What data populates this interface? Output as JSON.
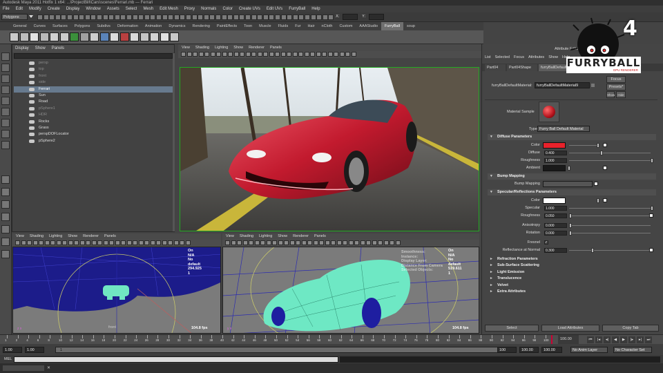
{
  "window": {
    "title": "Autodesk Maya 2011 Hotfix 1 x64: ...\\ProjectBill\\Cars\\scenes\\Ferrari.mb --- Ferrari"
  },
  "menu": [
    "File",
    "Edit",
    "Modify",
    "Create",
    "Display",
    "Window",
    "Assets",
    "Select",
    "Mesh",
    "Edit Mesh",
    "Proxy",
    "Normals",
    "Color",
    "Create UVs",
    "Edit UVs",
    "FurryBall",
    "Help"
  ],
  "status": {
    "mode": "Polygons",
    "x_label": "X:",
    "y_label": "Y:"
  },
  "shelf": {
    "tabs": [
      "General",
      "Curves",
      "Surfaces",
      "Polygons",
      "Subdivs",
      "Deformation",
      "Animation",
      "Dynamics",
      "Rendering",
      "PaintEffects",
      "Toon",
      "Muscle",
      "Fluids",
      "Fur",
      "Hair",
      "nCloth",
      "Custom",
      "AAAStudio",
      "FurryBall",
      "soup"
    ],
    "active_tab": "FurryBall",
    "icons": [
      "#c9c9c9",
      "#bdbdbd",
      "#e3e3e3",
      "#b8b8b8",
      "#d0d0d0",
      "#ccc",
      "#3b8f3b",
      "#a0a0a0",
      "#ccc",
      "#5a83b8",
      "#dcdcdc",
      "#b84040",
      "#dadada",
      "#c4c4c4",
      "#d3d3d3",
      "#e0e0e0",
      "#c7c7c7"
    ]
  },
  "outliner": {
    "menu": [
      "Display",
      "Show",
      "Panels"
    ],
    "items": [
      {
        "label": "persp",
        "state": "dim"
      },
      {
        "label": "top",
        "state": "dim"
      },
      {
        "label": "front",
        "state": "dim"
      },
      {
        "label": "side",
        "state": "dim"
      },
      {
        "label": "Ferrari",
        "state": "sel"
      },
      {
        "label": "Sun",
        "state": "normal"
      },
      {
        "label": "Road",
        "state": "normal"
      },
      {
        "label": "pSphere1",
        "state": "dim"
      },
      {
        "label": "HDR",
        "state": "dim"
      },
      {
        "label": "Rocks",
        "state": "normal"
      },
      {
        "label": "Grass",
        "state": "normal"
      },
      {
        "label": "perspDOFLocator",
        "state": "normal"
      },
      {
        "label": "pSphere2",
        "state": "normal"
      }
    ]
  },
  "render_view": {
    "menu": [
      "View",
      "Shading",
      "Lighting",
      "Show",
      "Renderer",
      "Panels"
    ]
  },
  "viewport_left": {
    "menu": [
      "View",
      "Shading",
      "Lighting",
      "Show",
      "Renderer",
      "Panels"
    ],
    "hud": [
      "On",
      "N/A",
      "No",
      "default",
      "294.925",
      "1"
    ],
    "fps": "104.8 fps",
    "label": "front"
  },
  "viewport_right": {
    "menu": [
      "View",
      "Shading",
      "Lighting",
      "Show",
      "Renderer",
      "Panels"
    ],
    "hud_labels": [
      "Smoothness:",
      "Instance:",
      "Display Layer:",
      "Distance From Camera:",
      "Selected Objects:"
    ],
    "hud": [
      "On",
      "N/A",
      "No",
      "default",
      "519.611",
      "1"
    ],
    "fps": "104.8 fps"
  },
  "attribute_editor": {
    "title": "Attribute Editor",
    "menu": [
      "List",
      "Selected",
      "Focus",
      "Attributes",
      "Show",
      "Help"
    ],
    "tabs": [
      "Part04",
      "Part04Shape",
      "furryBallDefaultMaterial9"
    ],
    "material_label": "furryBallDefaultMaterial:",
    "material_value": "furryBallDefaultMaterial9",
    "buttons": {
      "focus": "Focus",
      "presets": "Presets*",
      "show": "Show",
      "hide": "Hide"
    },
    "sample_label": "Material Sample",
    "type_label": "Type",
    "type_value": "Furry Ball Default Material",
    "diffuse": {
      "title": "Diffuse Parameters",
      "color_label": "Color",
      "color_value": "#e8222b",
      "diffuse_label": "Diffuse",
      "diffuse_value": "0.400",
      "roughness_label": "Roughness",
      "roughness_value": "1.000",
      "ambient_label": "Ambient",
      "ambient_value": "#1a1a1a"
    },
    "bump": {
      "title": "Bump Mapping",
      "label": "Bump Mapping"
    },
    "specular": {
      "title": "Specular/Reflections Parameters",
      "color_label": "Color",
      "color_value": "#ffffff",
      "specular_label": "Specular",
      "specular_value": "1.000",
      "roughness_label": "Roughness",
      "roughness_value": "0.050",
      "anisotropy_label": "Anisotropy",
      "anisotropy_value": "0.000",
      "rotation_label": "Rotation",
      "rotation_value": "0.000",
      "fresnel_label": "Fresnel",
      "reflectance_label": "Reflectance at Normal",
      "reflectance_value": "0.300"
    },
    "collapsed": [
      "Refraction Parameters",
      "Sub-Surface Scattering",
      "Light Emission",
      "Translucence",
      "Velvet",
      "Extra Attributes"
    ],
    "bottom_buttons": [
      "Select",
      "Load Attributes",
      "Copy Tab"
    ]
  },
  "logo": {
    "text": "FURRYBALL",
    "subtitle": "GPU RENDERER",
    "number": "4"
  },
  "timeline": {
    "ticks": [
      "1",
      "2",
      "4",
      "6",
      "8",
      "10",
      "12",
      "14",
      "16",
      "18",
      "20",
      "22",
      "24",
      "26",
      "28",
      "30",
      "32",
      "34",
      "36",
      "38",
      "40",
      "42",
      "44",
      "46",
      "48",
      "50",
      "52",
      "54",
      "56",
      "58",
      "60",
      "62",
      "64",
      "66",
      "68",
      "70",
      "72",
      "74",
      "76",
      "78",
      "80",
      "82",
      "84",
      "86",
      "88",
      "90",
      "92",
      "94",
      "96",
      "98",
      "100"
    ],
    "current": "100.00"
  },
  "range": {
    "start": "1.00",
    "inner_start": "1.00",
    "inner_field": "1",
    "end_inner": "100",
    "end": "100.00",
    "end2": "100.00",
    "anim_layer": "No Anim Layer",
    "char_set": "No Character Set"
  },
  "cmdline": {
    "label": "MEL"
  }
}
